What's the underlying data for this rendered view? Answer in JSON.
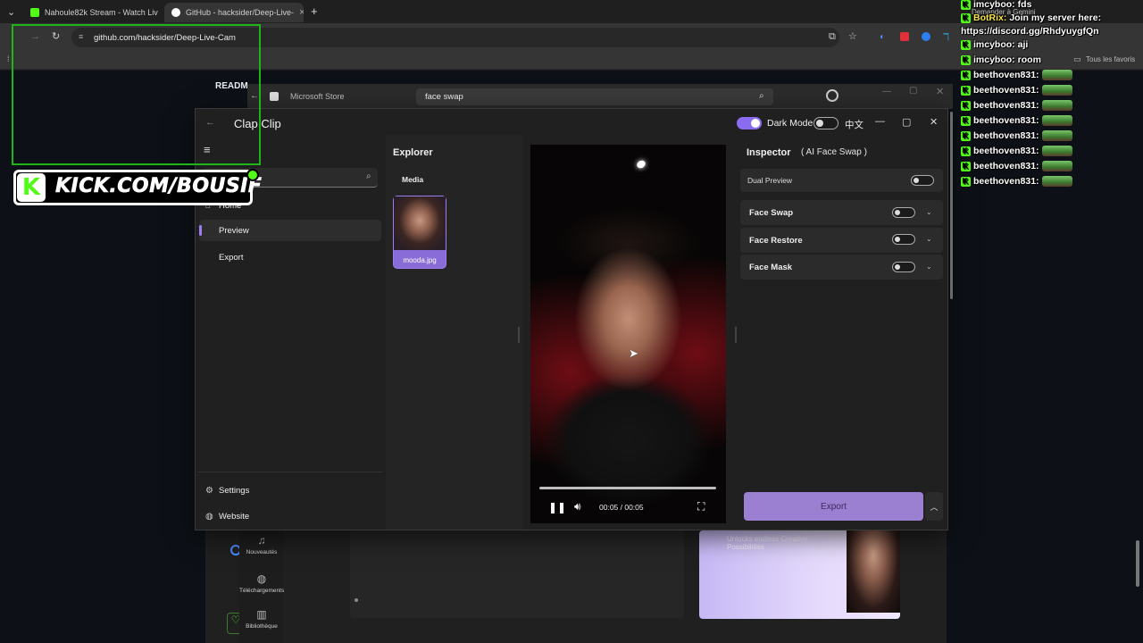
{
  "browser": {
    "tabs": [
      {
        "title": "Nahoule82k Stream - Watch Liv",
        "favicon_color": "#53fc18"
      },
      {
        "title": "GitHub - hacksider/Deep-Live-",
        "favicon_color": "#ffffff"
      }
    ],
    "new_tab": "+",
    "url": "github.com/hacksider/Deep-Live-Cam",
    "gemini_label": "Demander à Gemini",
    "bookmarks_label": "Tous les favoris"
  },
  "github": {
    "readme_tab": "READM"
  },
  "store": {
    "title": "Microsoft Store",
    "search_value": "face swap",
    "rail": [
      {
        "label": "Nouveautés",
        "icon": "bell-icon"
      },
      {
        "label": "Téléchargements",
        "icon": "download-icon"
      },
      {
        "label": "Bibliothèque",
        "icon": "library-icon"
      }
    ],
    "promo_text": "Unlocks endless Creative Possibilities"
  },
  "app": {
    "title": "Clap Clip",
    "dark_mode_label": "Dark Mode",
    "dark_mode_on": true,
    "lang_label": "中文",
    "lang_on": false,
    "nav": [
      {
        "label": "Home",
        "icon": "home-icon"
      },
      {
        "label": "Preview",
        "icon": "preview-icon",
        "active": true
      },
      {
        "label": "Export",
        "icon": "export-icon"
      }
    ],
    "footer_nav": [
      {
        "label": "Settings",
        "icon": "gear-icon"
      },
      {
        "label": "Website",
        "icon": "globe-icon"
      }
    ],
    "explorer": {
      "title": "Explorer",
      "media_label": "Media",
      "files": [
        {
          "name": "mooda.jpg"
        }
      ]
    },
    "player": {
      "time": "00:05 / 00:05",
      "progress": 1.0
    },
    "inspector": {
      "title": "Inspector",
      "subtitle": "( AI Face Swap )",
      "dual_preview_label": "Dual Preview",
      "panels": [
        {
          "label": "Face Swap",
          "enabled": false
        },
        {
          "label": "Face Restore",
          "enabled": false
        },
        {
          "label": "Face Mask",
          "enabled": false
        }
      ],
      "export_label": "Export"
    }
  },
  "overlay": {
    "kick_text": "KICK.COM/BOUSIF",
    "kick_logo": "K"
  },
  "chat": [
    {
      "user": "imcyboo:",
      "msg": "fds"
    },
    {
      "user": "BotRix:",
      "msg": "Join my server here:"
    },
    {
      "user": "",
      "msg": "https://discord.gg/RhdyuygfQn"
    },
    {
      "user": "imcyboo:",
      "msg": "aji"
    },
    {
      "user": "imcyboo:",
      "msg": "room"
    },
    {
      "user": "beethoven831:",
      "msg": ""
    },
    {
      "user": "beethoven831:",
      "msg": ""
    },
    {
      "user": "beethoven831:",
      "msg": ""
    },
    {
      "user": "beethoven831:",
      "msg": ""
    },
    {
      "user": "beethoven831:",
      "msg": ""
    },
    {
      "user": "beethoven831:",
      "msg": ""
    },
    {
      "user": "beethoven831:",
      "msg": ""
    },
    {
      "user": "beethoven831:",
      "msg": ""
    }
  ],
  "colors": {
    "accent": "#9b7ff2",
    "kick_green": "#53fc18",
    "export_button": "#9b7fd1"
  }
}
